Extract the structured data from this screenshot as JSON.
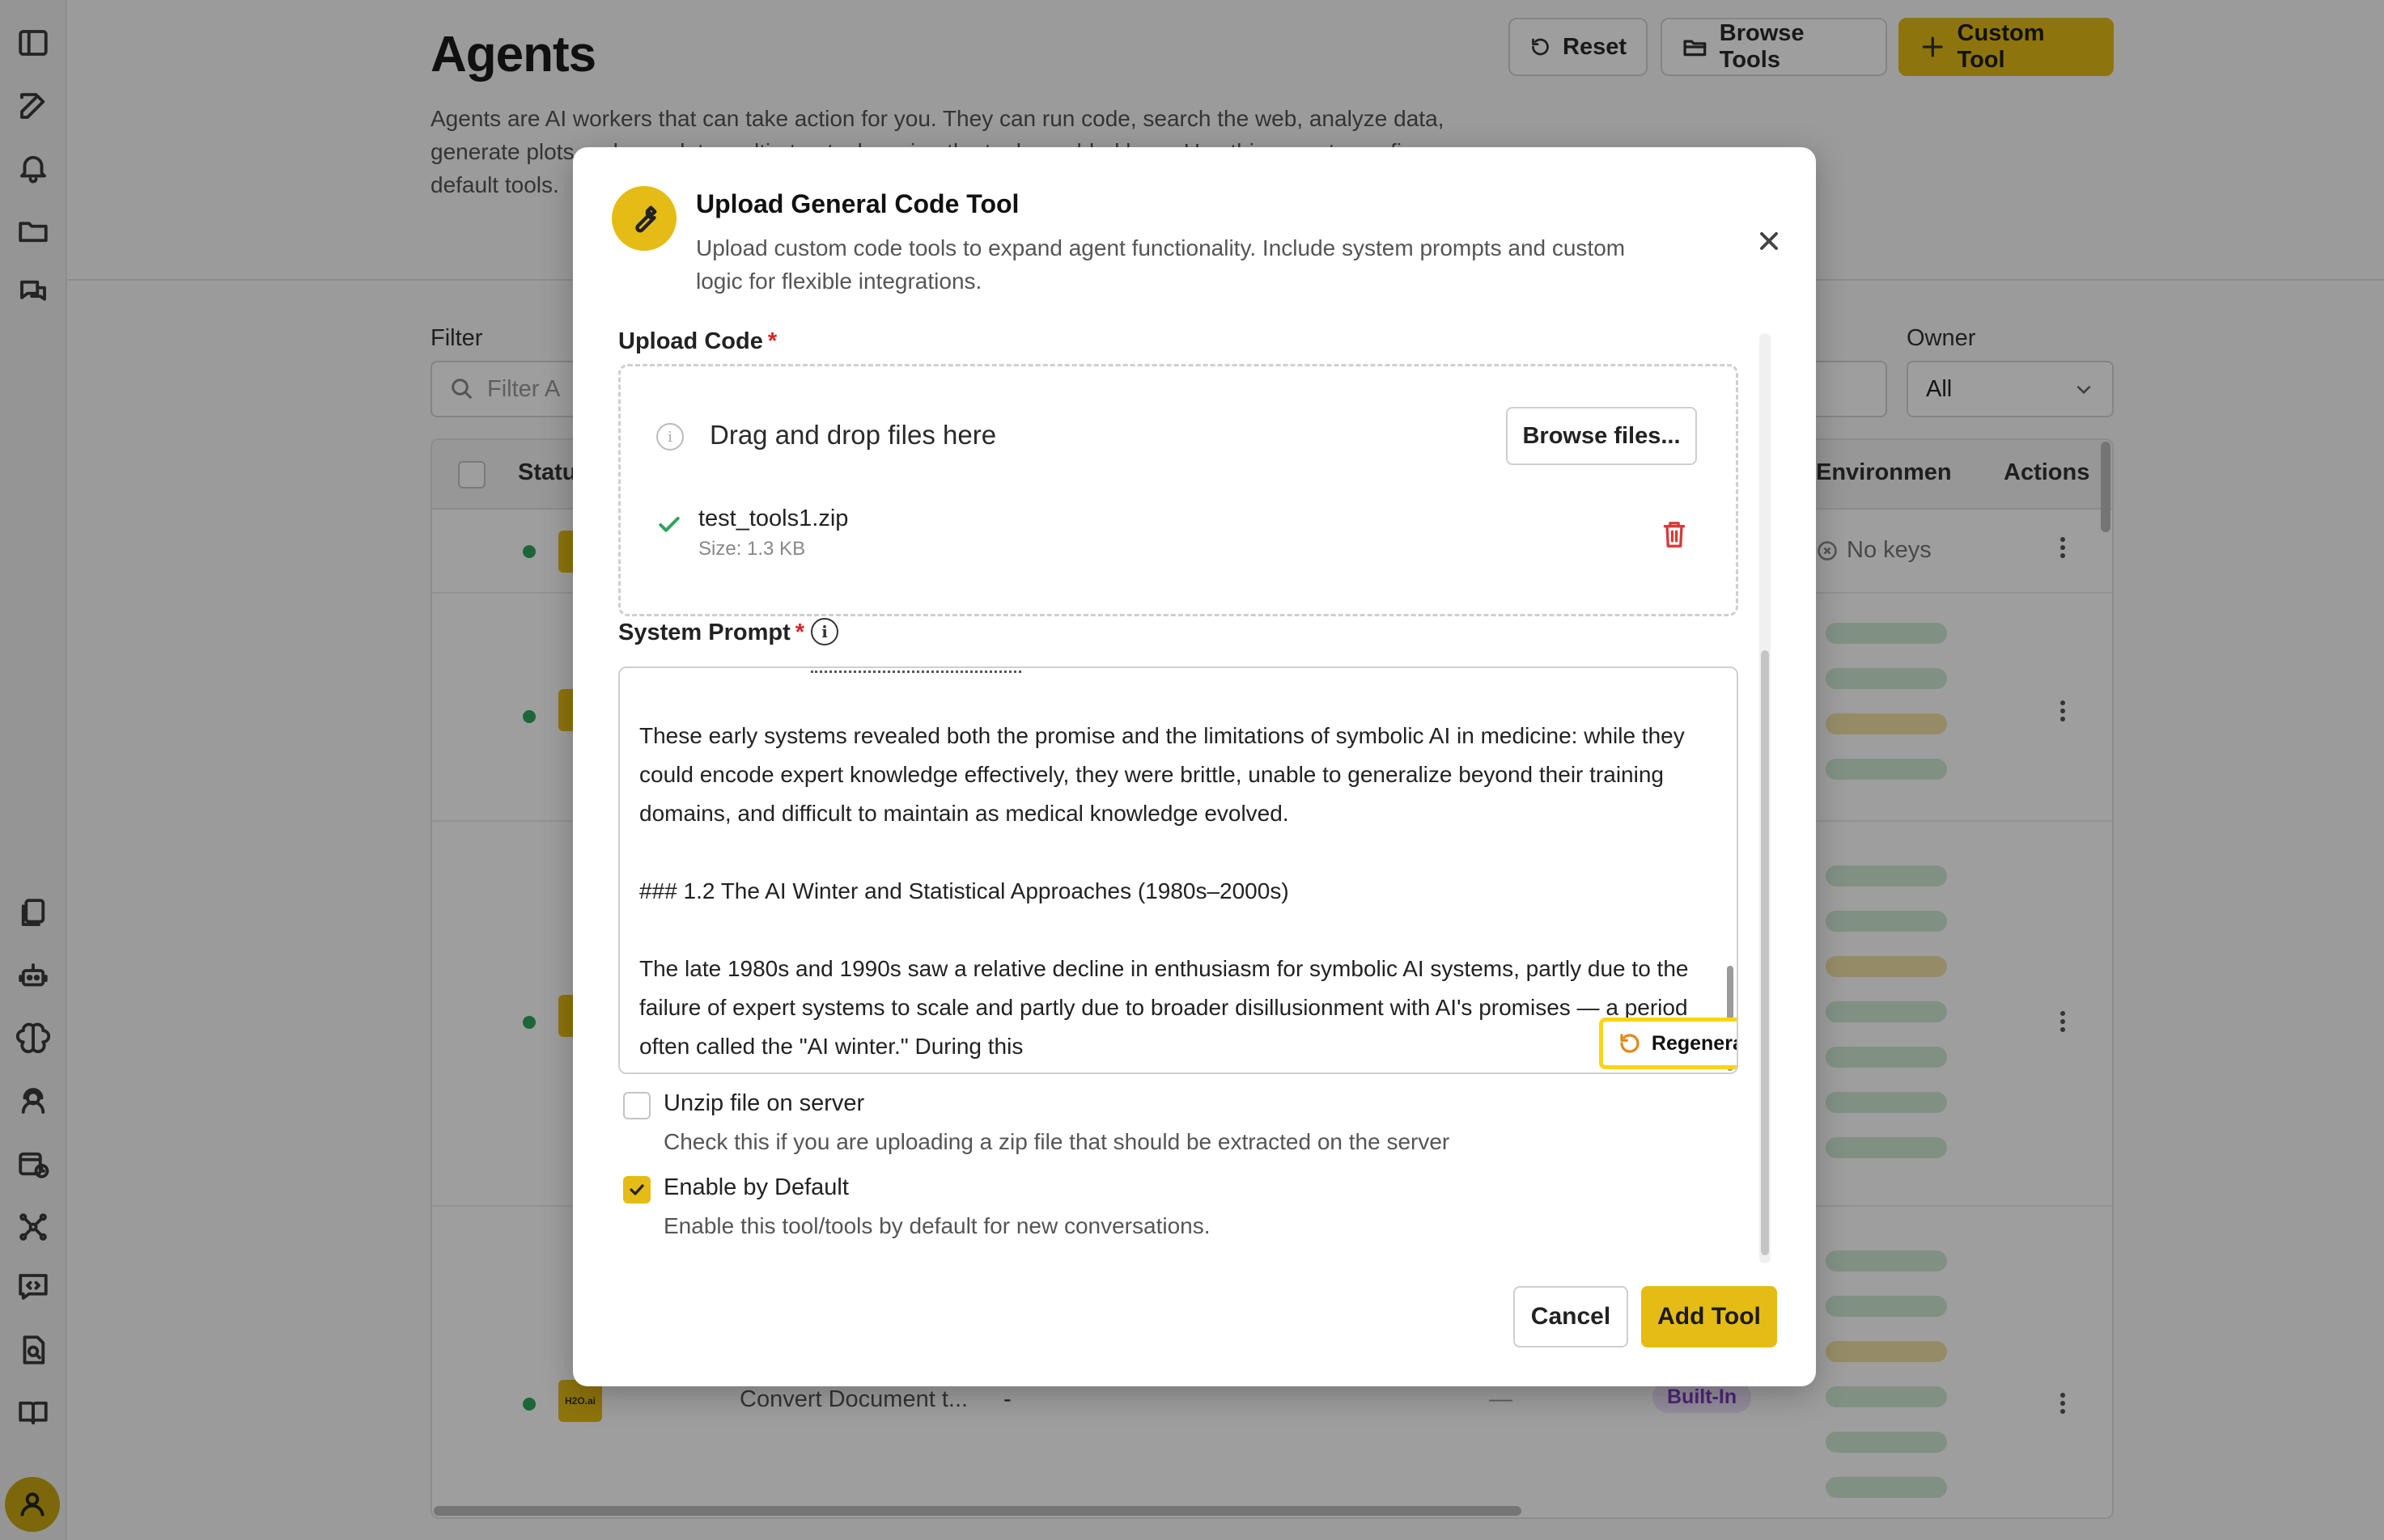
{
  "page": {
    "title": "Agents",
    "description": "Agents are AI workers that can take action for you. They can run code, search the web, analyze data, generate plots and complete multi-step tasks using the tools enabled here. Use this page to configure default tools.",
    "header_buttons": {
      "reset": "Reset",
      "browse_tools": "Browse Tools",
      "custom_tool": "Custom Tool"
    },
    "filter": {
      "label": "Filter",
      "placeholder": "Filter A"
    },
    "owner": {
      "label": "Owner",
      "value": "All"
    },
    "table": {
      "headers": {
        "status": "Statu",
        "environment": "Environmen",
        "actions": "Actions"
      },
      "first_row_env": "No keys",
      "last_row": {
        "name": "Convert Document t...",
        "dash1": "-",
        "dash2": "—",
        "badge": "Built-In",
        "logo": "H2O.ai"
      }
    }
  },
  "modal": {
    "title": "Upload General Code Tool",
    "subtitle": "Upload custom code tools to expand agent functionality. Include system prompts and custom logic for flexible integrations.",
    "upload_label": "Upload Code",
    "required_mark": "*",
    "dropzone_text": "Drag and drop files here",
    "browse_button": "Browse files...",
    "file": {
      "name": "test_tools1.zip",
      "size": "Size: 1.3 KB"
    },
    "system_prompt_label": "System Prompt",
    "system_prompt_text": "These early systems revealed both the promise and the limitations of symbolic AI in medicine: while they could encode expert knowledge effectively, they were brittle, unable to generalize beyond their training domains, and difficult to maintain as medical knowledge evolved.\n\n### 1.2 The AI Winter and Statistical Approaches (1980s–2000s)\n\nThe late 1980s and 1990s saw a relative decline in enthusiasm for symbolic AI systems, partly due to the failure of expert systems to scale and partly due to broader disillusionment with AI's promises — a period often called the \"AI winter.\" During this",
    "regenerate_button": "Regenerate",
    "options": [
      {
        "title": "Unzip file on server",
        "description": "Check this if you are uploading a zip file that should be extracted on the server",
        "checked": false
      },
      {
        "title": "Enable by Default",
        "description": "Enable this tool/tools by default for new conversations.",
        "checked": true
      }
    ],
    "cancel_button": "Cancel",
    "add_button": "Add Tool"
  },
  "colors": {
    "accent": "#e5bc15",
    "highlight": "#ffd21a",
    "danger": "#d63b3b",
    "success": "#2ea55a"
  }
}
